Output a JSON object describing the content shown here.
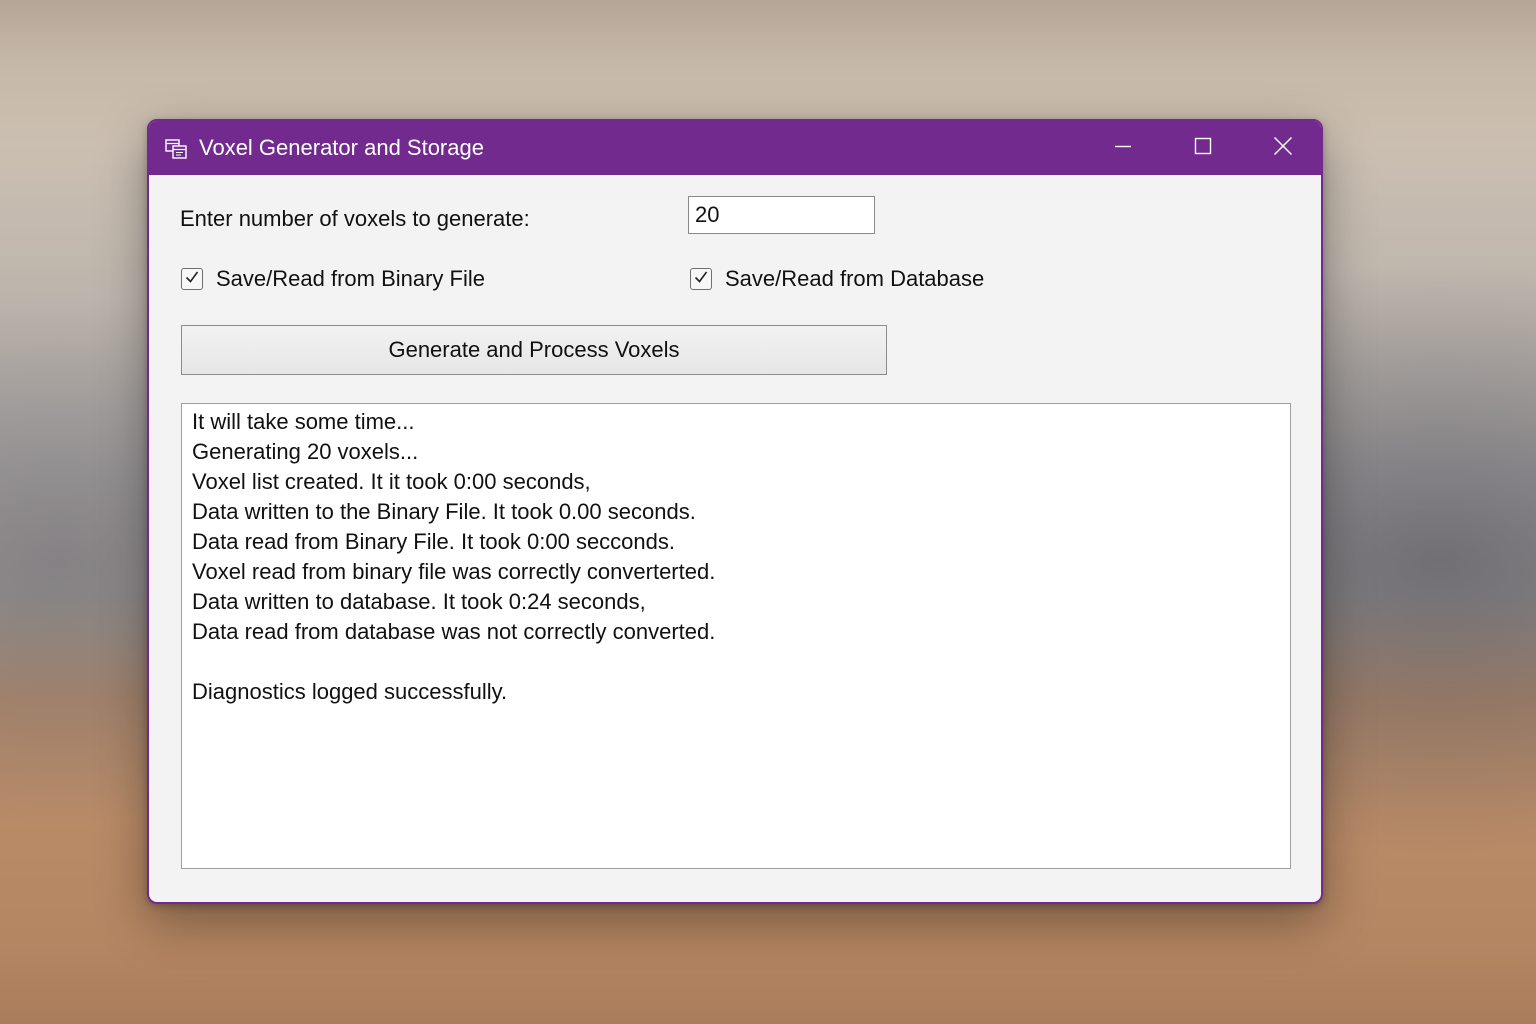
{
  "window": {
    "title": "Voxel Generator and Storage",
    "accent_color": "#722a8f",
    "controls": {
      "minimize_icon": "minimize-icon",
      "maximize_icon": "maximize-icon",
      "close_icon": "close-icon"
    }
  },
  "form": {
    "count_label": "Enter number of voxels to generate:",
    "count_value": "20",
    "binary_checkbox": {
      "label": "Save/Read from Binary File",
      "checked": true
    },
    "database_checkbox": {
      "label": "Save/Read from Database",
      "checked": true
    },
    "generate_label": "Generate and Process Voxels"
  },
  "output": {
    "lines": [
      "It will take some time...",
      "Generating 20 voxels...",
      "Voxel list created. It it took 0:00 seconds,",
      "Data written to the Binary File. It took 0.00 seconds.",
      "Data read from Binary File. It took 0:00 secconds.",
      "Voxel read from binary file was correctly converterted.",
      "Data written to database. It took 0:24 seconds,",
      "Data read from database was not correctly converted.",
      "",
      "Diagnostics logged successfully."
    ]
  }
}
